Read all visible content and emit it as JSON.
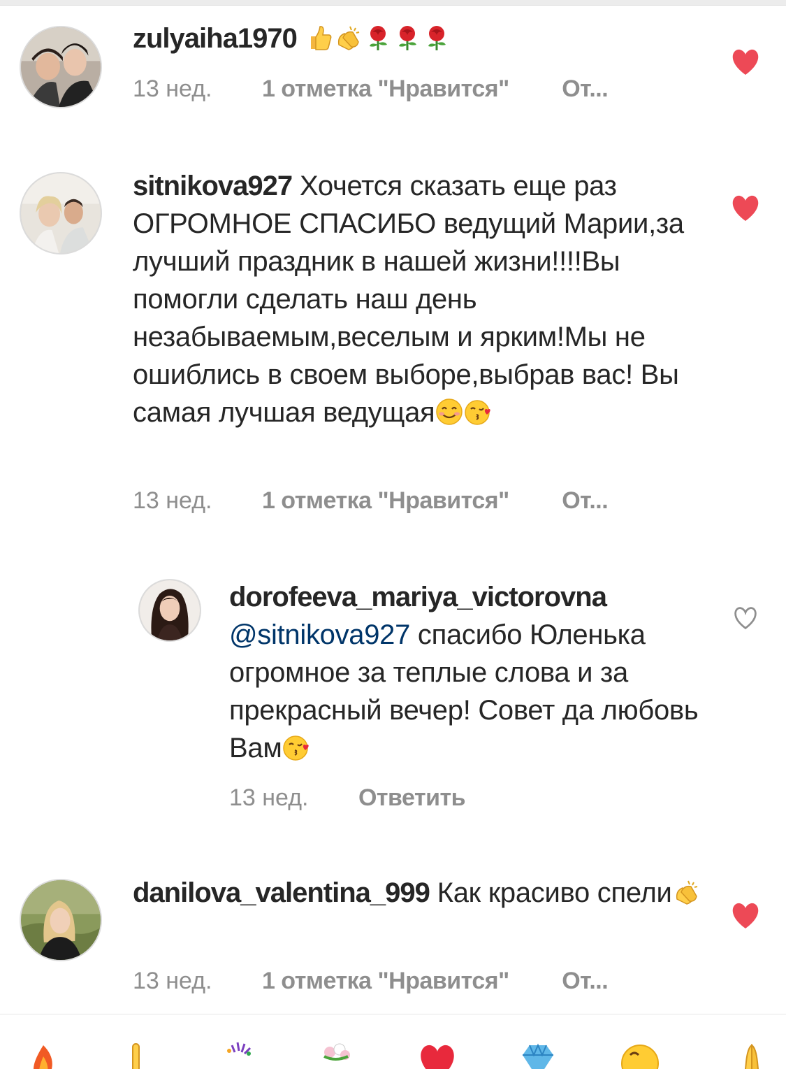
{
  "comments": [
    {
      "username": "zulyaiha1970",
      "text": "",
      "emojis": [
        "thumbs-up-emoji",
        "clapping-hands-emoji",
        "rose-emoji",
        "rose-emoji",
        "rose-emoji"
      ],
      "time": "13 нед.",
      "likes": "1 отметка \"Нравится\"",
      "reply": "От...",
      "liked": true
    },
    {
      "username": "sitnikova927",
      "text": "Хочется сказать еще раз ОГРОМНОЕ СПАСИБО ведущий Марии,за лучший праздник в нашей жизни!!!!Вы помогли сделать наш день незабываемым,веселым и ярким!Мы не ошиблись в своем выборе,выбрав вас! Вы самая лучшая ведущая",
      "emojis": [
        "smiling-face-emoji",
        "kissing-face-emoji"
      ],
      "time": "13 нед.",
      "likes": "1 отметка \"Нравится\"",
      "reply": "От...",
      "liked": true
    },
    {
      "username": "dorofeeva_mariya_victorovna",
      "mention": "@sitnikova927",
      "text": "спасибо Юленька огромное за теплые слова и за прекрасный вечер! Совет да любовь Вам",
      "emojis": [
        "kissing-face-emoji"
      ],
      "time": "13 нед.",
      "reply": "Ответить",
      "liked": false
    },
    {
      "username": "danilova_valentina_999",
      "text": "Как красиво спели",
      "emojis": [
        "clapping-hands-emoji"
      ],
      "time": "13 нед.",
      "likes": "1 отметка \"Нравится\"",
      "reply": "От...",
      "liked": true
    }
  ],
  "quick_reactions": [
    "fire-emoji",
    "raised-hand-emoji",
    "party-popper-emoji",
    "bouquet-emoji",
    "red-heart-emoji",
    "gem-emoji",
    "grinning-face-emoji",
    "folded-hands-emoji"
  ],
  "colors": {
    "text": "#262626",
    "meta": "#8e8e8e",
    "mention": "#003569",
    "heart": "#ed4956",
    "divider": "#e6e6e6"
  }
}
